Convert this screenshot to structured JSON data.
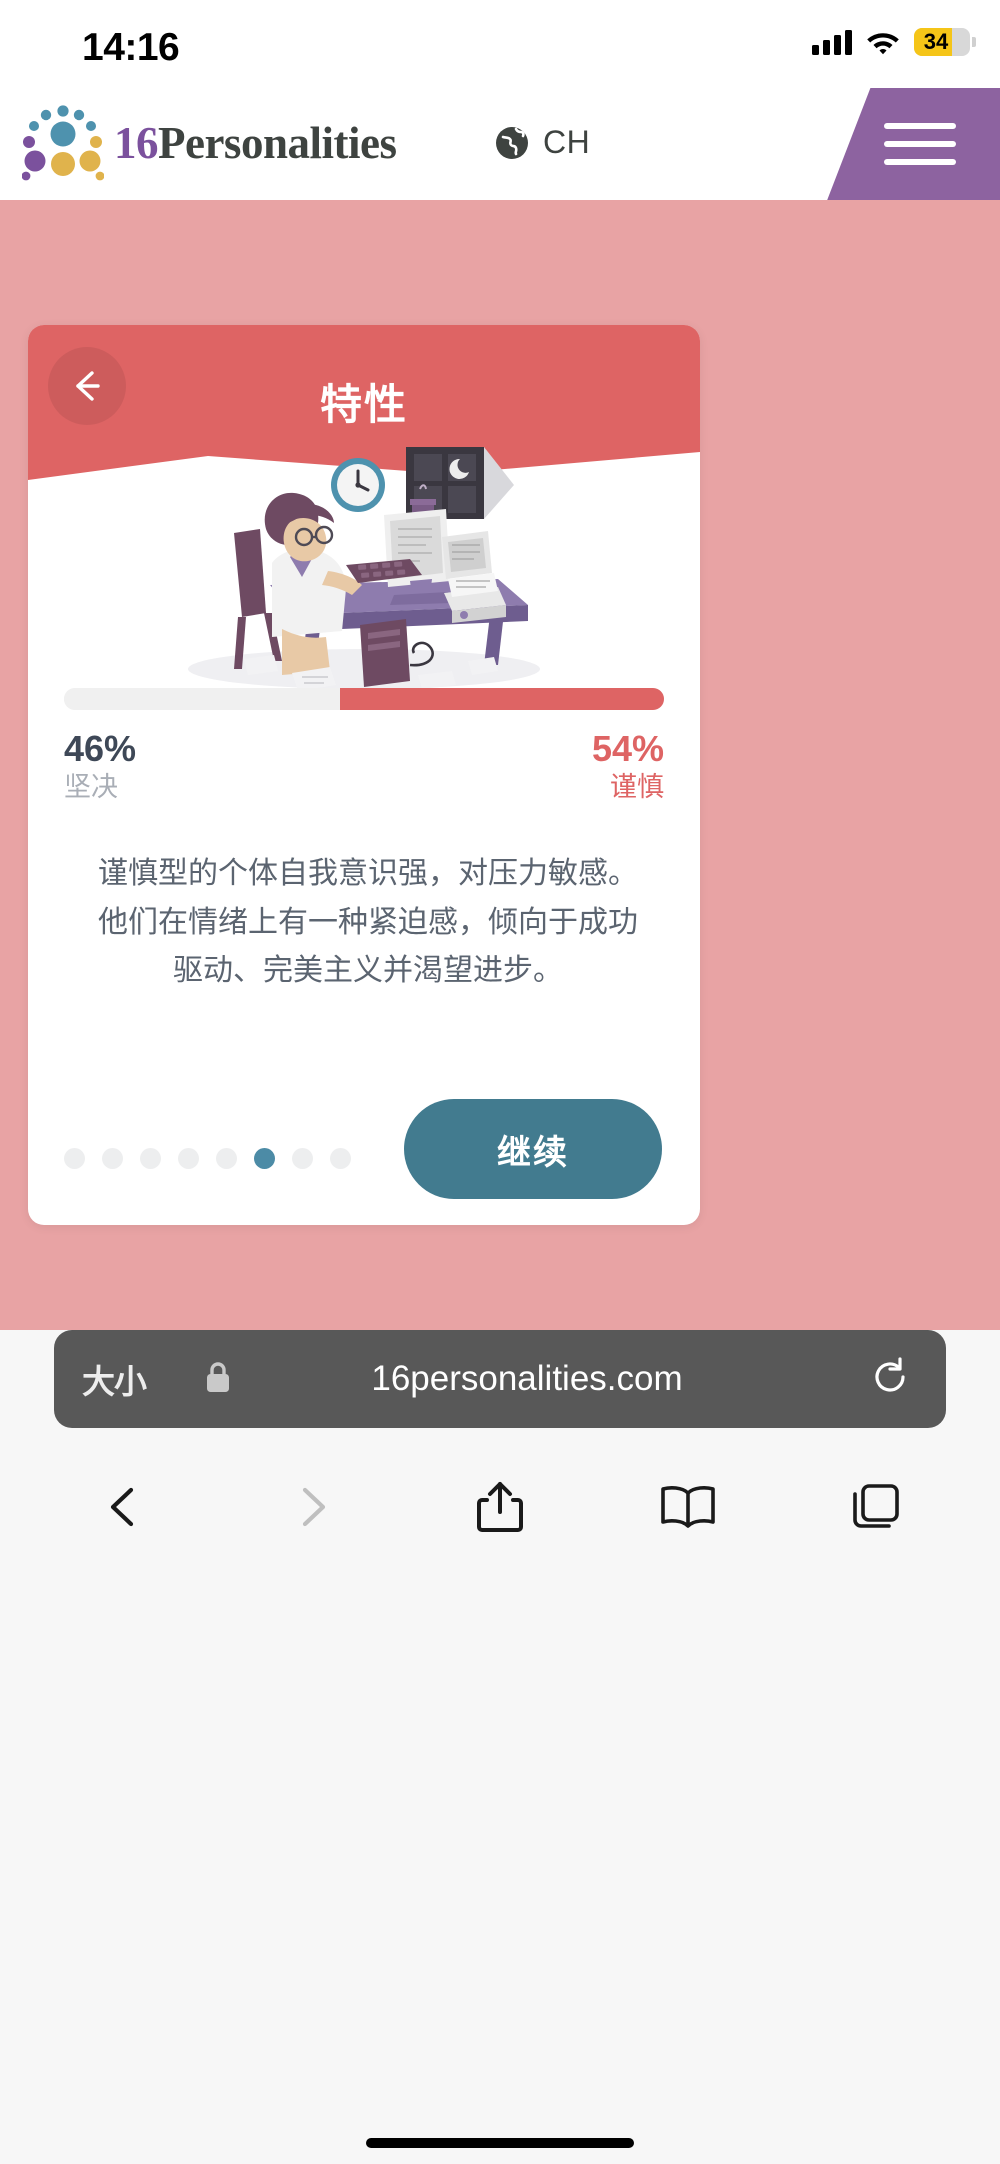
{
  "status_bar": {
    "time": "14:16",
    "battery_level": "34",
    "signal_icon": "cellular-bars-icon",
    "wifi_icon": "wifi-icon",
    "battery_icon": "battery-icon",
    "battery_fill_color": "#F5C518"
  },
  "site_header": {
    "brand_number": "16",
    "brand_word": "Personalities",
    "logo_icon": "personality-dots-logo-icon",
    "language_code": "CH",
    "globe_icon": "globe-icon",
    "menu_icon": "hamburger-menu-icon",
    "menu_color": "#8D63A0",
    "brand_number_color": "#7B519D",
    "brand_word_color": "#3E4340"
  },
  "stage": {
    "background_color": "#E8A3A4"
  },
  "card": {
    "header": {
      "title": "特性",
      "background_color": "#DE6464",
      "back_icon": "back-arrow-icon"
    },
    "illustration_name": "person-at-desk-night-illustration",
    "progress": {
      "left_percent_value": 46,
      "right_percent_value": 54,
      "left_track_color": "#F0F0F0",
      "right_fill_color": "#DE6464"
    },
    "stats": {
      "left": {
        "percent": "46%",
        "label": "坚决"
      },
      "right": {
        "percent": "54%",
        "label": "谨慎"
      }
    },
    "description": "谨慎型的个体自我意识强，对压力敏感。他们在情绪上有一种紧迫感，倾向于成功驱动、完美主义并渴望进步。",
    "pagination": {
      "total": 8,
      "active_index": 6,
      "active_color": "#4C8BA6",
      "inactive_color": "#EDEEEF"
    },
    "cta": {
      "label": "继续",
      "color": "#427B8F"
    }
  },
  "browser": {
    "text_size_label": "大小",
    "lock_icon": "lock-icon",
    "url": "16personalities.com",
    "reload_icon": "reload-icon",
    "nav": [
      {
        "name": "back-icon",
        "label": "Back"
      },
      {
        "name": "forward-icon",
        "label": "Forward"
      },
      {
        "name": "share-icon",
        "label": "Share"
      },
      {
        "name": "bookmarks-icon",
        "label": "Bookmarks"
      },
      {
        "name": "tabs-icon",
        "label": "Tabs"
      }
    ],
    "home_indicator": "home-indicator"
  }
}
